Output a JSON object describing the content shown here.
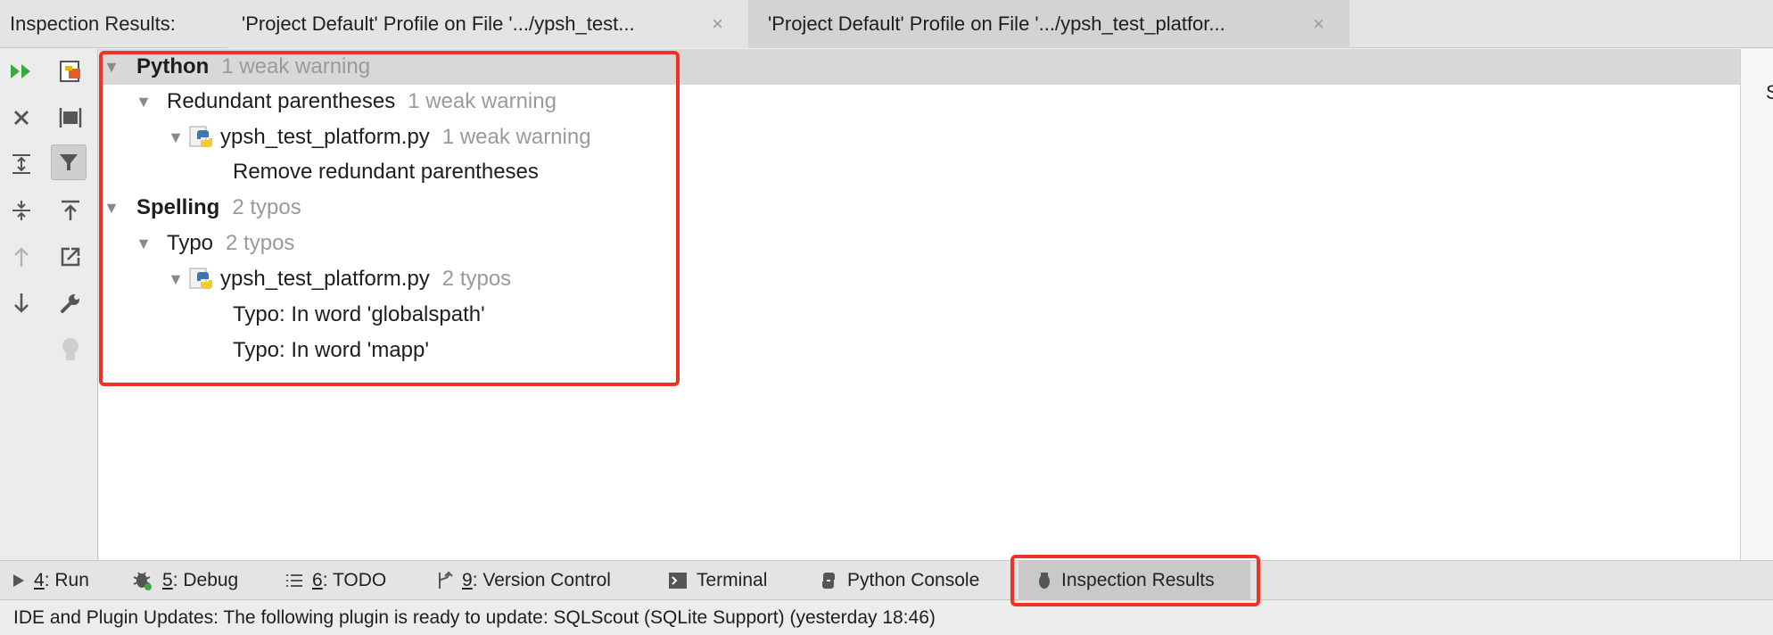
{
  "tabbar": {
    "title": "Inspection Results:",
    "tabs": [
      {
        "label": "'Project Default' Profile on File '.../ypsh_test..."
      },
      {
        "label": "'Project Default' Profile on File '.../ypsh_test_platfor..."
      }
    ],
    "close_glyph": "×"
  },
  "toolbar": {
    "icons": [
      "rerun-icon",
      "close-icon",
      "expand-all-icon",
      "collapse-all-icon",
      "previous-icon",
      "next-icon",
      "export-icon",
      "group-icon",
      "filter-icon",
      "autoscroll-icon",
      "open-editor-icon",
      "settings-wrench-icon",
      "quick-fix-bulb-icon"
    ]
  },
  "tree": {
    "rows": [
      {
        "label": "Python",
        "count": "1 weak warning"
      },
      {
        "label": "Redundant parentheses",
        "count": "1 weak warning"
      },
      {
        "label": "ypsh_test_platform.py",
        "count": "1 weak warning"
      },
      {
        "label": "Remove redundant parentheses",
        "count": ""
      },
      {
        "label": "Spelling",
        "count": "2 typos"
      },
      {
        "label": "Typo",
        "count": "2 typos"
      },
      {
        "label": "ypsh_test_platform.py",
        "count": "2 typos"
      },
      {
        "label": "Typo: In word 'globalspath'",
        "count": ""
      },
      {
        "label": "Typo: In word 'mapp'",
        "count": ""
      }
    ]
  },
  "right_strip": {
    "label": "S"
  },
  "bottom_tabs": [
    {
      "mnemonic": "4",
      "label": ": Run"
    },
    {
      "mnemonic": "5",
      "label": ": Debug"
    },
    {
      "mnemonic": "6",
      "label": ": TODO"
    },
    {
      "mnemonic": "9",
      "label": ": Version Control"
    },
    {
      "mnemonic": "",
      "label": "Terminal"
    },
    {
      "mnemonic": "",
      "label": "Python Console"
    },
    {
      "mnemonic": "",
      "label": "Inspection Results"
    }
  ],
  "status": {
    "text": "IDE and Plugin Updates: The following plugin is ready to update: SQLScout (SQLite Support) (yesterday 18:46)"
  },
  "colors": {
    "highlight": "#ee3326",
    "run_green": "#3aa83a",
    "python_blue": "#3b77b0",
    "python_yellow": "#f5c935"
  }
}
